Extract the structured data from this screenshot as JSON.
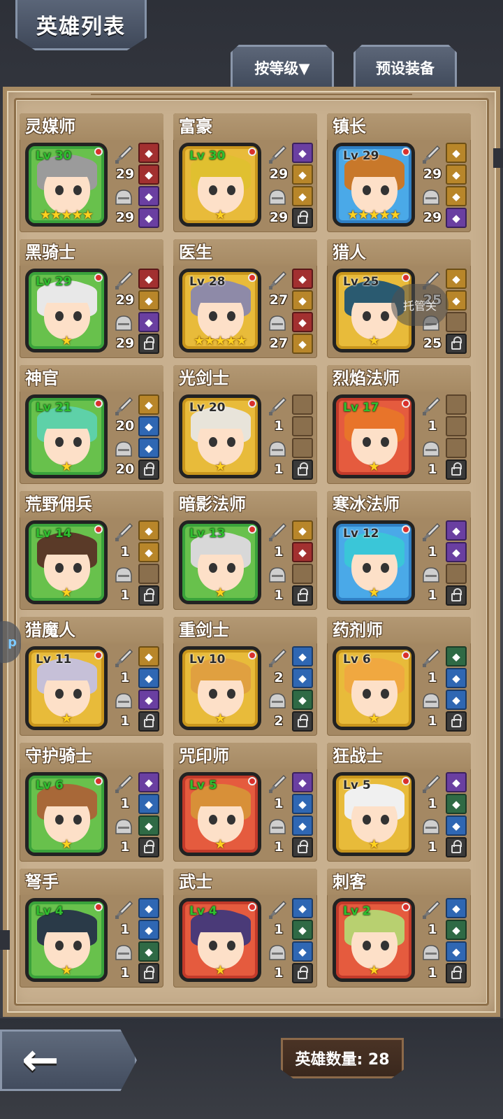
{
  "title": "英雄列表",
  "buttons": {
    "sort": "按等级▼",
    "preset": "预设装备",
    "back": "back-arrow"
  },
  "hero_count_label": "英雄数量: 28",
  "floating_tag": "托管关",
  "side_bubble": "p",
  "colors": {
    "panel": "#c8b08f",
    "card": "#a48863",
    "frame_green": "#3aa23b",
    "frame_gold": "#c9961d",
    "frame_blue": "#2f7fc4",
    "frame_red": "#c23a2a",
    "star": "#ffd21f"
  },
  "heroes": [
    {
      "name": "灵媒师",
      "level": "Lv 30",
      "stars": "★★★★★",
      "frame": "green",
      "weapon": "29",
      "armor": "29",
      "hair": "#9b9b9b",
      "slots": [
        "red",
        "red",
        "purple",
        "purple"
      ]
    },
    {
      "name": "富豪",
      "level": "Lv 30",
      "stars": "★",
      "frame": "gold",
      "weapon": "29",
      "armor": "29",
      "hair": "#e0c030",
      "slots": [
        "purple",
        "gold",
        "gold",
        "lock"
      ]
    },
    {
      "name": "镇长",
      "level": "Lv 29",
      "stars": "★★★★★",
      "frame": "blue",
      "weapon": "29",
      "armor": "29",
      "hair": "#c8782a",
      "slots": [
        "gold",
        "gold",
        "gold",
        "purple"
      ]
    },
    {
      "name": "黑骑士",
      "level": "Lv 29",
      "stars": "★",
      "frame": "green",
      "weapon": "29",
      "armor": "29",
      "hair": "#e8e8e8",
      "slots": [
        "red",
        "gold",
        "purple",
        "lock"
      ]
    },
    {
      "name": "医生",
      "level": "Lv 28",
      "stars": "★★★★★",
      "frame": "gold",
      "weapon": "27",
      "armor": "27",
      "hair": "#8e8aa8",
      "slots": [
        "red",
        "gold",
        "red",
        "gold"
      ]
    },
    {
      "name": "猎人",
      "level": "Lv 25",
      "stars": "★",
      "frame": "gold",
      "weapon": "25",
      "armor": "25",
      "hair": "#2a5a70",
      "slots": [
        "gold",
        "gold",
        "empty",
        "lock"
      ]
    },
    {
      "name": "神官",
      "level": "Lv 21",
      "stars": "★",
      "frame": "green",
      "weapon": "20",
      "armor": "20",
      "hair": "#5ed1a8",
      "slots": [
        "gold",
        "blue",
        "blue",
        "lock"
      ]
    },
    {
      "name": "光剑士",
      "level": "Lv 20",
      "stars": "★",
      "frame": "gold",
      "weapon": "1",
      "armor": "1",
      "hair": "#e8e4da",
      "slots": [
        "empty",
        "empty",
        "empty",
        "lock"
      ]
    },
    {
      "name": "烈焰法师",
      "level": "Lv 17",
      "stars": "★",
      "frame": "red",
      "weapon": "1",
      "armor": "1",
      "hair": "#e8742a",
      "slots": [
        "empty",
        "empty",
        "empty",
        "lock"
      ]
    },
    {
      "name": "荒野佣兵",
      "level": "Lv 14",
      "stars": "★",
      "frame": "green",
      "weapon": "1",
      "armor": "1",
      "hair": "#5a3a28",
      "slots": [
        "gold",
        "gold",
        "empty",
        "lock"
      ]
    },
    {
      "name": "暗影法师",
      "level": "Lv 13",
      "stars": "★",
      "frame": "green",
      "weapon": "1",
      "armor": "1",
      "hair": "#d8d8d8",
      "slots": [
        "gold",
        "red",
        "empty",
        "lock"
      ]
    },
    {
      "name": "寒冰法师",
      "level": "Lv 12",
      "stars": "★",
      "frame": "blue",
      "weapon": "1",
      "armor": "1",
      "hair": "#3ac6d8",
      "slots": [
        "purple",
        "purple",
        "empty",
        "lock"
      ]
    },
    {
      "name": "猎魔人",
      "level": "Lv 11",
      "stars": "★",
      "frame": "gold",
      "weapon": "1",
      "armor": "1",
      "hair": "#c6c0d8",
      "slots": [
        "gold",
        "blue",
        "purple",
        "lock"
      ]
    },
    {
      "name": "重剑士",
      "level": "Lv 10",
      "stars": "★",
      "frame": "gold",
      "weapon": "2",
      "armor": "2",
      "hair": "#e0a040",
      "slots": [
        "blue",
        "blue",
        "green",
        "lock"
      ]
    },
    {
      "name": "药剂师",
      "level": "Lv 6",
      "stars": "★",
      "frame": "gold",
      "weapon": "1",
      "armor": "1",
      "hair": "#f0a840",
      "slots": [
        "green",
        "blue",
        "blue",
        "lock"
      ]
    },
    {
      "name": "守护骑士",
      "level": "Lv 6",
      "stars": "★",
      "frame": "green",
      "weapon": "1",
      "armor": "1",
      "hair": "#a86838",
      "slots": [
        "purple",
        "blue",
        "green",
        "lock"
      ]
    },
    {
      "name": "咒印师",
      "level": "Lv 5",
      "stars": "★",
      "frame": "red",
      "weapon": "1",
      "armor": "1",
      "hair": "#d89038",
      "slots": [
        "purple",
        "blue",
        "blue",
        "lock"
      ]
    },
    {
      "name": "狂战士",
      "level": "Lv 5",
      "stars": "★",
      "frame": "gold",
      "weapon": "1",
      "armor": "1",
      "hair": "#f0f0f0",
      "slots": [
        "purple",
        "green",
        "blue",
        "lock"
      ]
    },
    {
      "name": "弩手",
      "level": "Lv 4",
      "stars": "★",
      "frame": "green",
      "weapon": "1",
      "armor": "1",
      "hair": "#2a3a48",
      "slots": [
        "blue",
        "blue",
        "green",
        "lock"
      ]
    },
    {
      "name": "武士",
      "level": "Lv 4",
      "stars": "★",
      "frame": "red",
      "weapon": "1",
      "armor": "1",
      "hair": "#4a3a78",
      "slots": [
        "blue",
        "green",
        "blue",
        "lock"
      ]
    },
    {
      "name": "刺客",
      "level": "Lv 2",
      "stars": "★",
      "frame": "red",
      "weapon": "1",
      "armor": "1",
      "hair": "#b8d070",
      "slots": [
        "blue",
        "green",
        "blue",
        "lock"
      ]
    }
  ]
}
